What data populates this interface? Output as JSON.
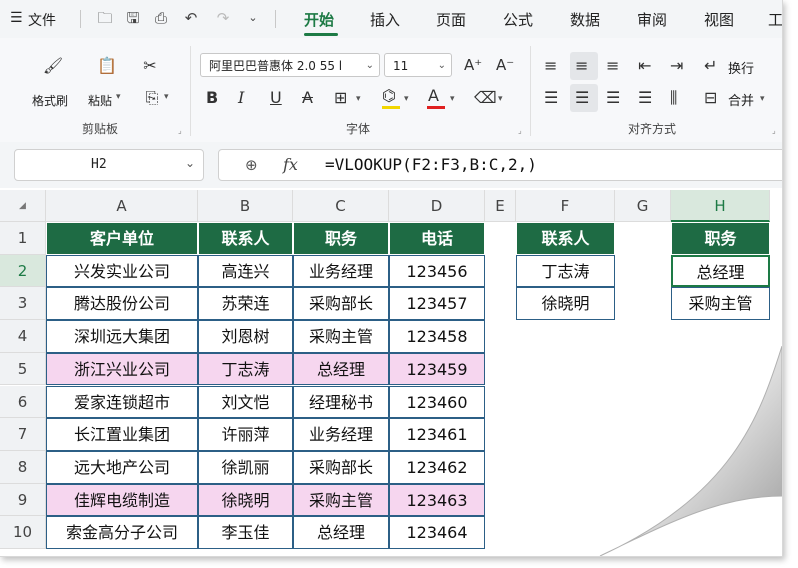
{
  "tabbar": {
    "menu_label": "文件",
    "tabs": [
      "开始",
      "插入",
      "页面",
      "公式",
      "数据",
      "审阅",
      "视图",
      "工"
    ],
    "active_tab": "开始"
  },
  "ribbon": {
    "clipboard": {
      "format_painter": "格式刷",
      "paste": "粘贴",
      "group_label": "剪贴板"
    },
    "font": {
      "font_name": "阿里巴巴普惠体 2.0 55 l",
      "font_size": "11",
      "group_label": "字体"
    },
    "alignment": {
      "wrap_text": "换行",
      "merge": "合并",
      "group_label": "对齐方式"
    },
    "colors": {
      "font_color_bar": "#e02020",
      "highlight_bar": "#f2d600"
    }
  },
  "formula_bar": {
    "name_box": "H2",
    "fx_label": "fx",
    "formula": "=VLOOKUP(F2:F3,B:C,2,)"
  },
  "columns": [
    "A",
    "B",
    "C",
    "D",
    "E",
    "F",
    "G",
    "H"
  ],
  "rows": [
    "1",
    "2",
    "3",
    "4",
    "5",
    "6",
    "7",
    "8",
    "9",
    "10"
  ],
  "table": {
    "headers": [
      "客户单位",
      "联系人",
      "职务",
      "电话"
    ],
    "data": [
      [
        "兴发实业公司",
        "高连兴",
        "业务经理",
        "123456"
      ],
      [
        "腾达股份公司",
        "苏荣连",
        "采购部长",
        "123457"
      ],
      [
        "深圳远大集团",
        "刘恩树",
        "采购主管",
        "123458"
      ],
      [
        "浙江兴业公司",
        "丁志涛",
        "总经理",
        "123459"
      ],
      [
        "爱家连锁超市",
        "刘文恺",
        "经理秘书",
        "123460"
      ],
      [
        "长江置业集团",
        "许丽萍",
        "业务经理",
        "123461"
      ],
      [
        "远大地产公司",
        "徐凯丽",
        "采购部长",
        "123462"
      ],
      [
        "佳辉电缆制造",
        "徐晓明",
        "采购主管",
        "123463"
      ],
      [
        "索金高分子公司",
        "李玉佳",
        "总经理",
        "123464"
      ]
    ]
  },
  "lookup": {
    "f_header": "联系人",
    "f_values": [
      "丁志涛",
      "徐晓明"
    ],
    "h_header": "职务",
    "h_values": [
      "总经理",
      "采购主管"
    ]
  },
  "colors": {
    "header_green": "#1e6b44",
    "highlight_pink": "#f6d6ef",
    "selection_green": "#1d7a45"
  }
}
